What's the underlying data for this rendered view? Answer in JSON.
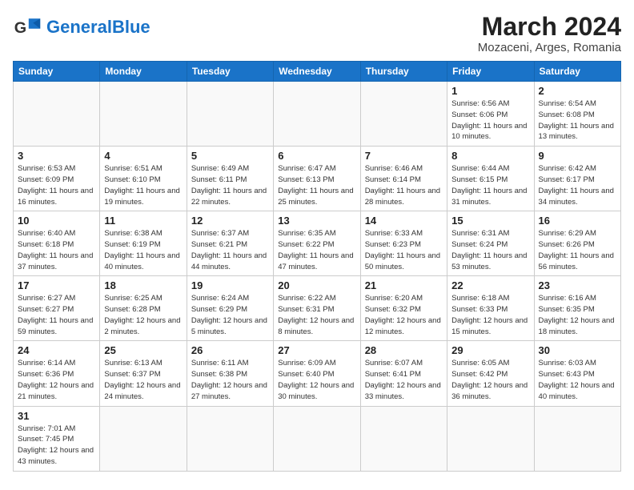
{
  "header": {
    "logo_general": "General",
    "logo_blue": "Blue",
    "title": "March 2024",
    "subtitle": "Mozaceni, Arges, Romania"
  },
  "weekdays": [
    "Sunday",
    "Monday",
    "Tuesday",
    "Wednesday",
    "Thursday",
    "Friday",
    "Saturday"
  ],
  "weeks": [
    [
      {
        "day": "",
        "info": ""
      },
      {
        "day": "",
        "info": ""
      },
      {
        "day": "",
        "info": ""
      },
      {
        "day": "",
        "info": ""
      },
      {
        "day": "",
        "info": ""
      },
      {
        "day": "1",
        "info": "Sunrise: 6:56 AM\nSunset: 6:06 PM\nDaylight: 11 hours and 10 minutes."
      },
      {
        "day": "2",
        "info": "Sunrise: 6:54 AM\nSunset: 6:08 PM\nDaylight: 11 hours and 13 minutes."
      }
    ],
    [
      {
        "day": "3",
        "info": "Sunrise: 6:53 AM\nSunset: 6:09 PM\nDaylight: 11 hours and 16 minutes."
      },
      {
        "day": "4",
        "info": "Sunrise: 6:51 AM\nSunset: 6:10 PM\nDaylight: 11 hours and 19 minutes."
      },
      {
        "day": "5",
        "info": "Sunrise: 6:49 AM\nSunset: 6:11 PM\nDaylight: 11 hours and 22 minutes."
      },
      {
        "day": "6",
        "info": "Sunrise: 6:47 AM\nSunset: 6:13 PM\nDaylight: 11 hours and 25 minutes."
      },
      {
        "day": "7",
        "info": "Sunrise: 6:46 AM\nSunset: 6:14 PM\nDaylight: 11 hours and 28 minutes."
      },
      {
        "day": "8",
        "info": "Sunrise: 6:44 AM\nSunset: 6:15 PM\nDaylight: 11 hours and 31 minutes."
      },
      {
        "day": "9",
        "info": "Sunrise: 6:42 AM\nSunset: 6:17 PM\nDaylight: 11 hours and 34 minutes."
      }
    ],
    [
      {
        "day": "10",
        "info": "Sunrise: 6:40 AM\nSunset: 6:18 PM\nDaylight: 11 hours and 37 minutes."
      },
      {
        "day": "11",
        "info": "Sunrise: 6:38 AM\nSunset: 6:19 PM\nDaylight: 11 hours and 40 minutes."
      },
      {
        "day": "12",
        "info": "Sunrise: 6:37 AM\nSunset: 6:21 PM\nDaylight: 11 hours and 44 minutes."
      },
      {
        "day": "13",
        "info": "Sunrise: 6:35 AM\nSunset: 6:22 PM\nDaylight: 11 hours and 47 minutes."
      },
      {
        "day": "14",
        "info": "Sunrise: 6:33 AM\nSunset: 6:23 PM\nDaylight: 11 hours and 50 minutes."
      },
      {
        "day": "15",
        "info": "Sunrise: 6:31 AM\nSunset: 6:24 PM\nDaylight: 11 hours and 53 minutes."
      },
      {
        "day": "16",
        "info": "Sunrise: 6:29 AM\nSunset: 6:26 PM\nDaylight: 11 hours and 56 minutes."
      }
    ],
    [
      {
        "day": "17",
        "info": "Sunrise: 6:27 AM\nSunset: 6:27 PM\nDaylight: 11 hours and 59 minutes."
      },
      {
        "day": "18",
        "info": "Sunrise: 6:25 AM\nSunset: 6:28 PM\nDaylight: 12 hours and 2 minutes."
      },
      {
        "day": "19",
        "info": "Sunrise: 6:24 AM\nSunset: 6:29 PM\nDaylight: 12 hours and 5 minutes."
      },
      {
        "day": "20",
        "info": "Sunrise: 6:22 AM\nSunset: 6:31 PM\nDaylight: 12 hours and 8 minutes."
      },
      {
        "day": "21",
        "info": "Sunrise: 6:20 AM\nSunset: 6:32 PM\nDaylight: 12 hours and 12 minutes."
      },
      {
        "day": "22",
        "info": "Sunrise: 6:18 AM\nSunset: 6:33 PM\nDaylight: 12 hours and 15 minutes."
      },
      {
        "day": "23",
        "info": "Sunrise: 6:16 AM\nSunset: 6:35 PM\nDaylight: 12 hours and 18 minutes."
      }
    ],
    [
      {
        "day": "24",
        "info": "Sunrise: 6:14 AM\nSunset: 6:36 PM\nDaylight: 12 hours and 21 minutes."
      },
      {
        "day": "25",
        "info": "Sunrise: 6:13 AM\nSunset: 6:37 PM\nDaylight: 12 hours and 24 minutes."
      },
      {
        "day": "26",
        "info": "Sunrise: 6:11 AM\nSunset: 6:38 PM\nDaylight: 12 hours and 27 minutes."
      },
      {
        "day": "27",
        "info": "Sunrise: 6:09 AM\nSunset: 6:40 PM\nDaylight: 12 hours and 30 minutes."
      },
      {
        "day": "28",
        "info": "Sunrise: 6:07 AM\nSunset: 6:41 PM\nDaylight: 12 hours and 33 minutes."
      },
      {
        "day": "29",
        "info": "Sunrise: 6:05 AM\nSunset: 6:42 PM\nDaylight: 12 hours and 36 minutes."
      },
      {
        "day": "30",
        "info": "Sunrise: 6:03 AM\nSunset: 6:43 PM\nDaylight: 12 hours and 40 minutes."
      }
    ],
    [
      {
        "day": "31",
        "info": "Sunrise: 7:01 AM\nSunset: 7:45 PM\nDaylight: 12 hours and 43 minutes."
      },
      {
        "day": "",
        "info": ""
      },
      {
        "day": "",
        "info": ""
      },
      {
        "day": "",
        "info": ""
      },
      {
        "day": "",
        "info": ""
      },
      {
        "day": "",
        "info": ""
      },
      {
        "day": "",
        "info": ""
      }
    ]
  ]
}
